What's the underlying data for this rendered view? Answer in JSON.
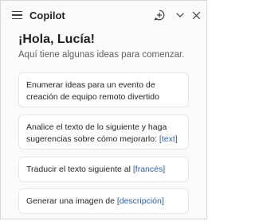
{
  "header": {
    "title": "Copilot",
    "icons": {
      "menu": "hamburger-menu-icon",
      "new_chat": "new-chat-icon",
      "minimize": "chevron-down-icon",
      "close": "close-icon"
    }
  },
  "greeting": "¡Hola, Lucía!",
  "subtitle": "Aquí tiene algunas ideas para comenzar.",
  "suggestions": [
    {
      "text": "Enumerar ideas para un evento de creación de equipo remoto divertido",
      "placeholder": ""
    },
    {
      "text": "Analice el texto de lo siguiente y haga sugerencias sobre cómo mejorarlo: ",
      "placeholder": "[text]"
    },
    {
      "text": "Traducir el texto siguiente al ",
      "placeholder": "[francés]"
    },
    {
      "text": "Generar una imagen de ",
      "placeholder": "[descripción]"
    }
  ],
  "colors": {
    "placeholder": "#2b5fb4",
    "card_border": "#e6e6e6",
    "pane_background": "#fafafa"
  }
}
